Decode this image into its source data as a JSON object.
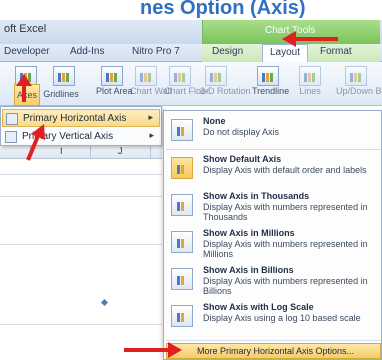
{
  "heading": {
    "text": "nes Option (Axis)"
  },
  "window": {
    "app_title": "oft Excel",
    "chart_tools": "Chart Tools"
  },
  "tabs": [
    {
      "label": "Developer"
    },
    {
      "label": "Add-Ins"
    },
    {
      "label": "Nitro Pro 7"
    },
    {
      "label": "Design"
    },
    {
      "label": "Layout"
    },
    {
      "label": "Format"
    }
  ],
  "ribbon": {
    "buttons": [
      {
        "label": ""
      },
      {
        "label": ""
      },
      {
        "label": "Axes"
      },
      {
        "label": "Gridlines"
      },
      {
        "label": "Plot Area"
      },
      {
        "label": "Chart Wall"
      },
      {
        "label": "Chart Floor"
      },
      {
        "label": "3-D Rotation"
      },
      {
        "label": "Trendline"
      },
      {
        "label": "Lines"
      },
      {
        "label": "Up/Down Bars"
      }
    ]
  },
  "worksheet": {
    "columns": [
      "I",
      "J"
    ]
  },
  "submenu": {
    "items": [
      {
        "label": "Primary Horizontal Axis",
        "arrow": "▸"
      },
      {
        "label": "Primary Vertical Axis",
        "arrow": "▸"
      }
    ]
  },
  "options": [
    {
      "title": "None",
      "desc": "Do not display Axis"
    },
    {
      "title": "Show Default Axis",
      "desc": "Display Axis with default order and labels"
    },
    {
      "title": "Show Axis in Thousands",
      "desc": "Display Axis with numbers represented in Thousands"
    },
    {
      "title": "Show Axis in Millions",
      "desc": "Display Axis with numbers represented in Millions"
    },
    {
      "title": "Show Axis in Billions",
      "desc": "Display Axis with numbers represented in Billions"
    },
    {
      "title": "Show Axis with Log Scale",
      "desc": "Display Axis using a log 10 based scale"
    }
  ],
  "more_options": "More Primary Horizontal Axis Options...",
  "colors": {
    "accent": "#2f6fc4",
    "chart_tools": "#7cc35c",
    "highlight": "#f9d98a",
    "annotation": "#e02020"
  }
}
